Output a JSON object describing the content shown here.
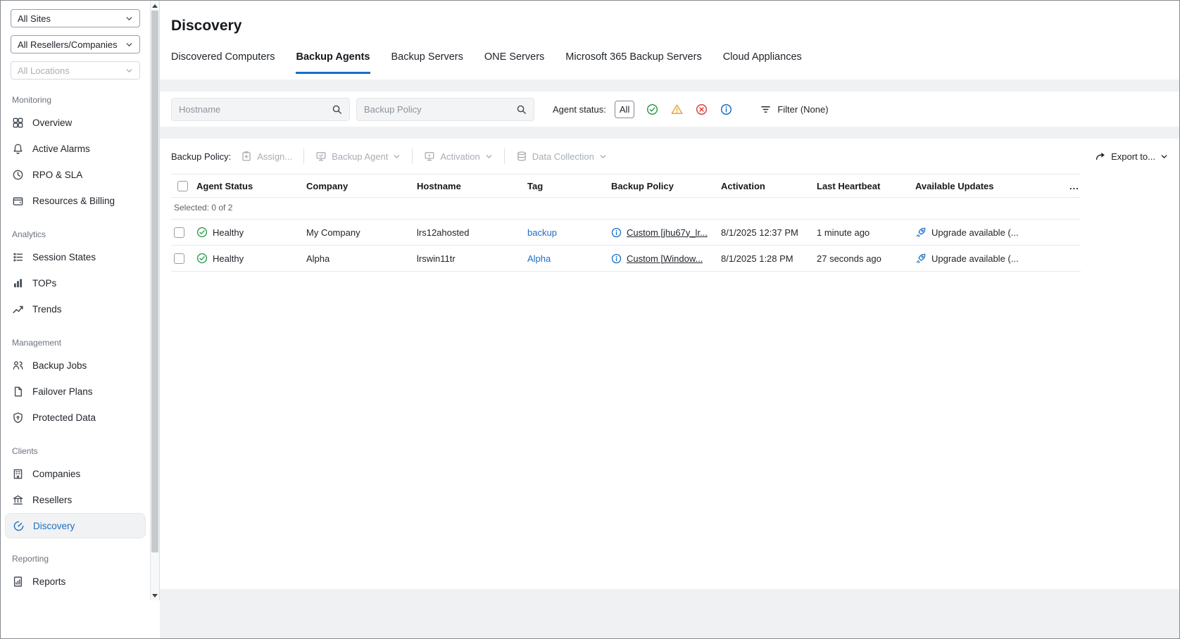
{
  "colors": {
    "accent_blue": "#1a6fc4",
    "healthy_green": "#2f9e4f",
    "warning_orange": "#e9a23b",
    "error_red": "#d9453d",
    "info_blue": "#1a6fc4"
  },
  "sidebar": {
    "site_filter": "All Sites",
    "reseller_filter": "All Resellers/Companies",
    "location_filter": "All Locations",
    "sections": [
      {
        "label": "Monitoring",
        "items": [
          {
            "label": "Overview"
          },
          {
            "label": "Active Alarms"
          },
          {
            "label": "RPO & SLA"
          },
          {
            "label": "Resources & Billing"
          }
        ]
      },
      {
        "label": "Analytics",
        "items": [
          {
            "label": "Session States"
          },
          {
            "label": "TOPs"
          },
          {
            "label": "Trends"
          }
        ]
      },
      {
        "label": "Management",
        "items": [
          {
            "label": "Backup Jobs"
          },
          {
            "label": "Failover Plans"
          },
          {
            "label": "Protected Data"
          }
        ]
      },
      {
        "label": "Clients",
        "items": [
          {
            "label": "Companies"
          },
          {
            "label": "Resellers"
          },
          {
            "label": "Discovery"
          }
        ]
      },
      {
        "label": "Reporting",
        "items": [
          {
            "label": "Reports"
          }
        ]
      }
    ]
  },
  "page": {
    "title": "Discovery"
  },
  "tabs": [
    {
      "label": "Discovered Computers"
    },
    {
      "label": "Backup Agents"
    },
    {
      "label": "Backup Servers"
    },
    {
      "label": "ONE Servers"
    },
    {
      "label": "Microsoft 365 Backup Servers"
    },
    {
      "label": "Cloud Appliances"
    }
  ],
  "filters": {
    "hostname_placeholder": "Hostname",
    "backup_policy_placeholder": "Backup Policy",
    "agent_status_label": "Agent status:",
    "all_button": "All",
    "filter_button": "Filter (None)"
  },
  "toolbar": {
    "backup_policy_label": "Backup Policy:",
    "assign": "Assign...",
    "backup_agent": "Backup Agent",
    "activation": "Activation",
    "data_collection": "Data Collection",
    "export": "Export to..."
  },
  "table": {
    "selected_summary": "Selected: 0 of 2",
    "columns": {
      "agent_status": "Agent Status",
      "company": "Company",
      "hostname": "Hostname",
      "tag": "Tag",
      "backup_policy": "Backup Policy",
      "activation": "Activation",
      "last_heartbeat": "Last Heartbeat",
      "available_updates": "Available Updates",
      "more": "..."
    },
    "rows": [
      {
        "status": "Healthy",
        "company": "My Company",
        "hostname": "lrs12ahosted",
        "tag": "backup",
        "backup_policy": "Custom [jhu67y_lr...",
        "activation": "8/1/2025 12:37 PM",
        "last_heartbeat": "1 minute ago",
        "available_updates": "Upgrade available (..."
      },
      {
        "status": "Healthy",
        "company": "Alpha",
        "hostname": "lrswin11tr",
        "tag": "Alpha",
        "backup_policy": "Custom [Window...",
        "activation": "8/1/2025 1:28 PM",
        "last_heartbeat": "27 seconds ago",
        "available_updates": "Upgrade available (..."
      }
    ]
  }
}
